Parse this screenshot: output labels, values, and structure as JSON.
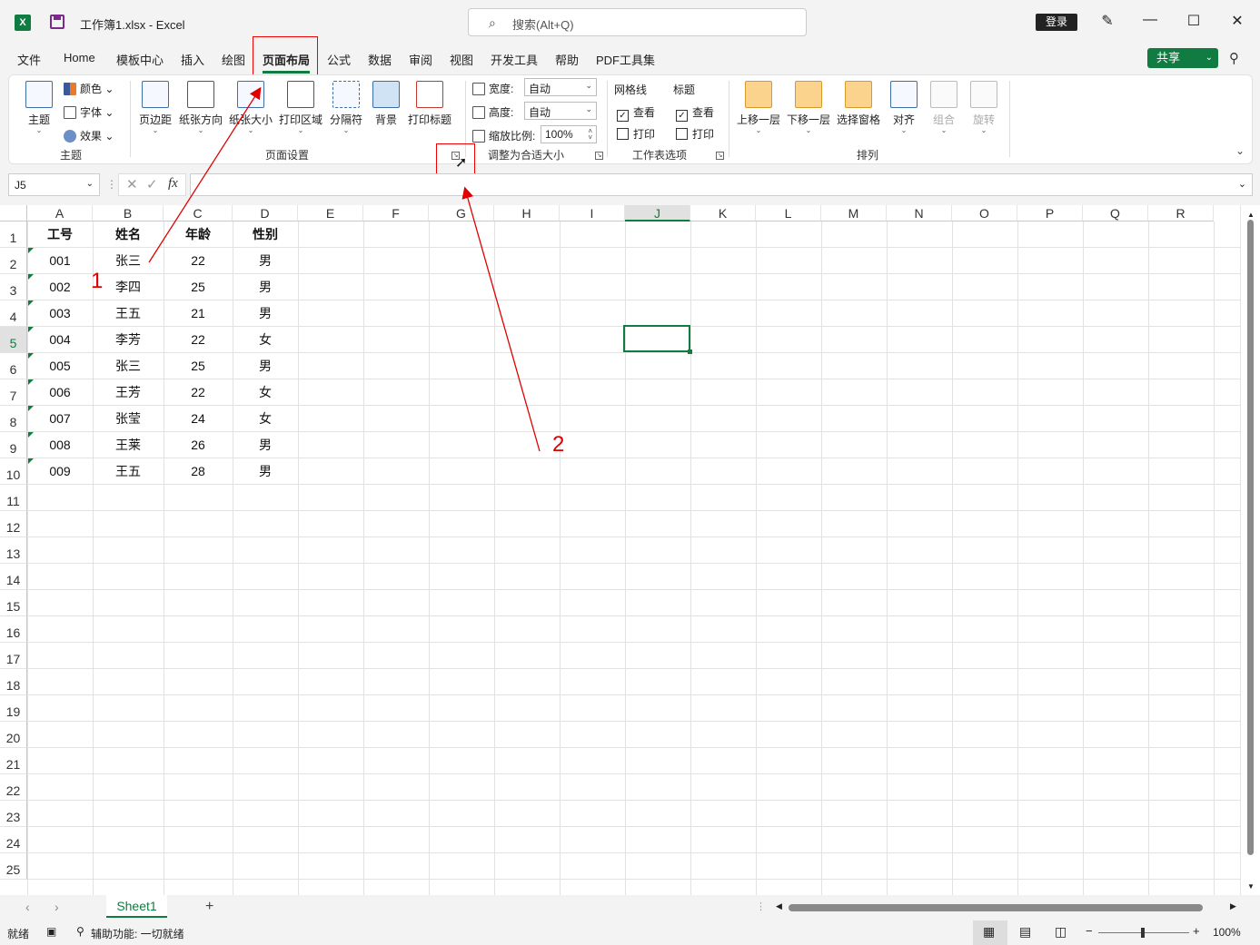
{
  "titlebar": {
    "doc_title": "工作簿1.xlsx  -  Excel",
    "search_placeholder": "搜索(Alt+Q)",
    "login_label": "登录",
    "app_icon_letter": "X"
  },
  "menu": {
    "items": [
      "文件",
      "Home",
      "模板中心",
      "插入",
      "绘图",
      "页面布局",
      "公式",
      "数据",
      "审阅",
      "视图",
      "开发工具",
      "帮助",
      "PDF工具集"
    ],
    "active": "页面布局",
    "share_label": "共享"
  },
  "ribbon": {
    "theme": {
      "button": "主题",
      "colors": "颜色",
      "fonts": "字体",
      "effects": "效果",
      "group_label": "主题"
    },
    "page_setup": {
      "buttons": [
        "页边距",
        "纸张方向",
        "纸张大小",
        "打印区域",
        "分隔符",
        "背景",
        "打印标题"
      ],
      "group_label": "页面设置"
    },
    "scale": {
      "width_label": "宽度:",
      "width_value": "自动",
      "height_label": "高度:",
      "height_value": "自动",
      "zoom_label": "缩放比例:",
      "zoom_value": "100%",
      "group_label": "调整为合适大小"
    },
    "sheet_options": {
      "gridlines": "网格线",
      "headings": "标题",
      "view": "查看",
      "print": "打印",
      "group_label": "工作表选项"
    },
    "arrange": {
      "buttons": [
        "上移一层",
        "下移一层",
        "选择窗格",
        "对齐",
        "组合",
        "旋转"
      ],
      "group_label": "排列"
    }
  },
  "formula_bar": {
    "name_box": "J5",
    "fx": "fx"
  },
  "sheet": {
    "columns": [
      "A",
      "B",
      "C",
      "D",
      "E",
      "F",
      "G",
      "H",
      "I",
      "J",
      "K",
      "L",
      "M",
      "N",
      "O",
      "P",
      "Q",
      "R"
    ],
    "selected_column": "J",
    "selected_row": "5",
    "rows": [
      "1",
      "2",
      "3",
      "4",
      "5",
      "6",
      "7",
      "8",
      "9",
      "10",
      "11",
      "12",
      "13",
      "14",
      "15",
      "16",
      "17",
      "18",
      "19",
      "20",
      "21",
      "22",
      "23",
      "24",
      "25"
    ],
    "header": [
      "工号",
      "姓名",
      "年龄",
      "性别"
    ],
    "data": [
      [
        "001",
        "张三",
        "22",
        "男"
      ],
      [
        "002",
        "李四",
        "25",
        "男"
      ],
      [
        "003",
        "王五",
        "21",
        "男"
      ],
      [
        "004",
        "李芳",
        "22",
        "女"
      ],
      [
        "005",
        "张三",
        "25",
        "男"
      ],
      [
        "006",
        "王芳",
        "22",
        "女"
      ],
      [
        "007",
        "张莹",
        "24",
        "女"
      ],
      [
        "008",
        "王莱",
        "26",
        "男"
      ],
      [
        "009",
        "王五",
        "28",
        "男"
      ]
    ],
    "tab_name": "Sheet1"
  },
  "annotations": {
    "label_1": "1",
    "label_2": "2",
    "color": "#e00000"
  },
  "statusbar": {
    "ready": "就绪",
    "accessibility": "辅助功能: 一切就绪",
    "zoom": "100%"
  },
  "colors": {
    "accent": "#107c41",
    "annotation": "#e00000"
  }
}
